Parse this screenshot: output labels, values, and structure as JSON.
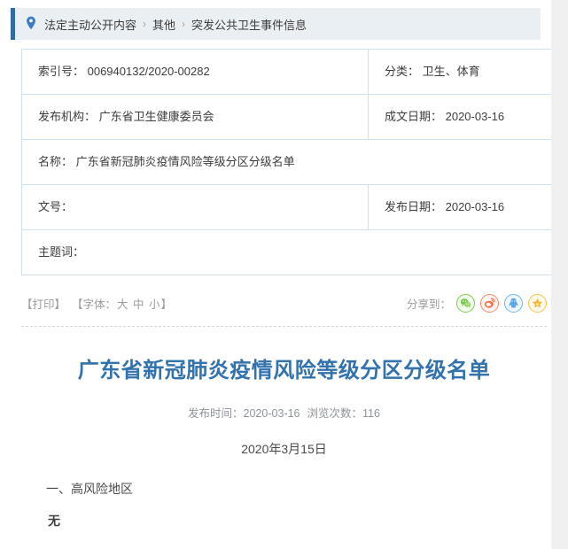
{
  "breadcrumb": {
    "icon": "map-pin-icon",
    "separator": "›",
    "items": [
      "法定主动公开内容",
      "其他",
      "突发公共卫生事件信息"
    ]
  },
  "info_table": {
    "rows": [
      {
        "left": "索引号： 006940132/2020-00282",
        "right": "分类： 卫生、体育",
        "full": false
      },
      {
        "left": "发布机构： 广东省卫生健康委员会",
        "right": "成文日期： 2020-03-16",
        "full": false
      },
      {
        "left": "名称： 广东省新冠肺炎疫情风险等级分区分级名单",
        "right": "",
        "full": true
      },
      {
        "left": "文号：",
        "right": "发布日期： 2020-03-16",
        "full": false
      },
      {
        "left": "主题词：",
        "right": "",
        "full": true
      }
    ]
  },
  "tools": {
    "print_label": "【打印】",
    "font_prefix": "【字体：",
    "font_large": "大",
    "font_medium": "中",
    "font_small": "小",
    "font_suffix": "】",
    "share_label": "分享到：",
    "share_items": [
      {
        "name": "wechat-icon",
        "color": "#6bbf3c"
      },
      {
        "name": "weibo-icon",
        "color": "#f2714b"
      },
      {
        "name": "qq-icon",
        "color": "#5aa9e6"
      },
      {
        "name": "favorite-star-icon",
        "color": "#f5b731"
      }
    ]
  },
  "article": {
    "title": "广东省新冠肺炎疫情风险等级分区分级名单",
    "publish_time_label": "发布时间：2020-03-16",
    "views_label": "浏览次数：116",
    "date_line": "2020年3月15日",
    "section_heading": "一、高风险地区",
    "section_content": "无"
  },
  "colors": {
    "accent_blue": "#2f6ca5",
    "title_blue": "#3272ad",
    "table_border": "#cfe0ee",
    "breadcrumb_bg": "#eaeff3"
  }
}
